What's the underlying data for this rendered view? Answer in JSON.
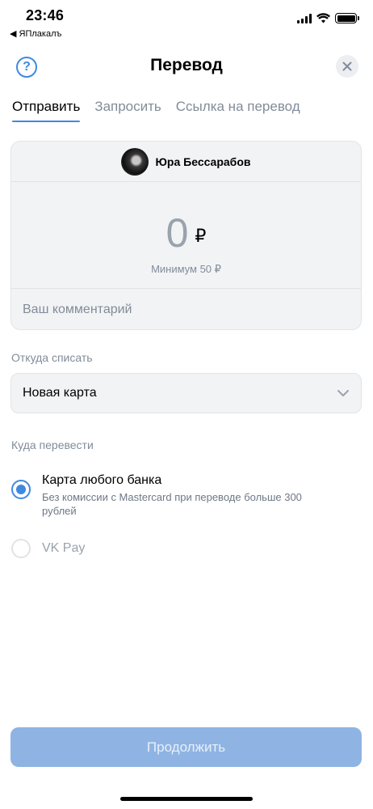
{
  "status_bar": {
    "time": "23:46",
    "back_app": "◀ ЯПлакалъ"
  },
  "header": {
    "title": "Перевод",
    "help_glyph": "?",
    "help_icon": "question-circle-icon",
    "close_icon": "close-icon"
  },
  "tabs": [
    {
      "label": "Отправить",
      "active": true
    },
    {
      "label": "Запросить",
      "active": false
    },
    {
      "label": "Ссылка на перевод",
      "active": false
    }
  ],
  "transfer": {
    "recipient_name": "Юра Бессарабов",
    "amount": "0",
    "currency": "₽",
    "min_hint": "Минимум 50 ₽",
    "comment_placeholder": "Ваш комментарий"
  },
  "source": {
    "label": "Откуда списать",
    "selected": "Новая карта"
  },
  "destination": {
    "label": "Куда перевести",
    "options": [
      {
        "title": "Карта любого банка",
        "description": "Без комиссии с Mastercard при переводе больше 300 рублей",
        "selected": true
      },
      {
        "title": "VK Pay",
        "description": "",
        "selected": false
      }
    ]
  },
  "actions": {
    "continue_label": "Продолжить"
  },
  "colors": {
    "accent": "#3f8ae0",
    "button_disabled": "#8fb4e3",
    "secondary_text": "#818c99"
  }
}
